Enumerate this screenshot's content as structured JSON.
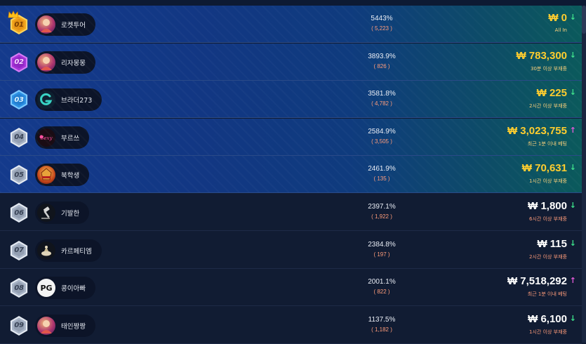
{
  "colors": {
    "gold_amount": "#ffcd2e",
    "white_amount": "#ffffff",
    "count_text": "#ff9c7a",
    "trend_down": "#3ce08a",
    "trend_up": "#e25ad8",
    "top_row_bg": "#143a8c",
    "rest_row_bg": "#111c33"
  },
  "rows": [
    {
      "rank": "01",
      "badge": "gold",
      "crown": true,
      "avatar_icon": "game-avatar-icon",
      "name": "로켓투어",
      "pct": "5443%",
      "count": "( 5,223 )",
      "amount": "₩ 0",
      "sub": "All In",
      "trend": "↓",
      "trend_dir": "down"
    },
    {
      "rank": "02",
      "badge": "purple",
      "crown": false,
      "avatar_icon": "game-avatar-icon",
      "name": "리자몽몽",
      "pct": "3893.9%",
      "count": "( 826 )",
      "amount": "₩ 783,300",
      "sub": "30분 이상 부재중",
      "trend": "↓",
      "trend_dir": "down"
    },
    {
      "rank": "03",
      "badge": "blue",
      "crown": false,
      "avatar_icon": "g-logo-icon",
      "name": "브라더273",
      "pct": "3581.8%",
      "count": "( 4,782 )",
      "amount": "₩ 225",
      "sub": "2시간 이상 부재중",
      "trend": "↓",
      "trend_dir": "down"
    },
    {
      "rank": "04",
      "badge": "gray",
      "crown": false,
      "avatar_icon": "sexy-logo-icon",
      "name": "부르쓰",
      "pct": "2584.9%",
      "count": "( 3,505 )",
      "amount": "₩ 3,023,755",
      "sub": "최근 1분 이내 베팅",
      "trend": "↑",
      "trend_dir": "up"
    },
    {
      "rank": "05",
      "badge": "gray",
      "crown": false,
      "avatar_icon": "egypt-game-icon",
      "name": "북학생",
      "pct": "2461.9%",
      "count": "( 135 )",
      "amount": "₩ 70,631",
      "sub": "1시간 이상 부재중",
      "trend": "↓",
      "trend_dir": "down"
    },
    {
      "rank": "06",
      "badge": "gray",
      "crown": false,
      "avatar_icon": "gavel-icon",
      "name": "기발한",
      "pct": "2397.1%",
      "count": "( 1,922 )",
      "amount": "₩ 1,800",
      "sub": "6시간 이상 부재중",
      "trend": "↓",
      "trend_dir": "down"
    },
    {
      "rank": "07",
      "badge": "gray",
      "crown": false,
      "avatar_icon": "genie-lamp-icon",
      "name": "카르페티엠",
      "pct": "2384.8%",
      "count": "( 197 )",
      "amount": "₩ 115",
      "sub": "2시간 이상 부재중",
      "trend": "↓",
      "trend_dir": "down"
    },
    {
      "rank": "08",
      "badge": "gray",
      "crown": false,
      "avatar_icon": "pg-logo-icon",
      "name": "콩이아빠",
      "pct": "2001.1%",
      "count": "( 822 )",
      "amount": "₩ 7,518,292",
      "sub": "최근 1분 이내 베팅",
      "trend": "↑",
      "trend_dir": "up"
    },
    {
      "rank": "09",
      "badge": "gray",
      "crown": false,
      "avatar_icon": "game-avatar-icon",
      "name": "태인짱짱",
      "pct": "1137.5%",
      "count": "( 1,182 )",
      "amount": "₩ 6,100",
      "sub": "1시간 이상 부재중",
      "trend": "↓",
      "trend_dir": "down"
    }
  ]
}
